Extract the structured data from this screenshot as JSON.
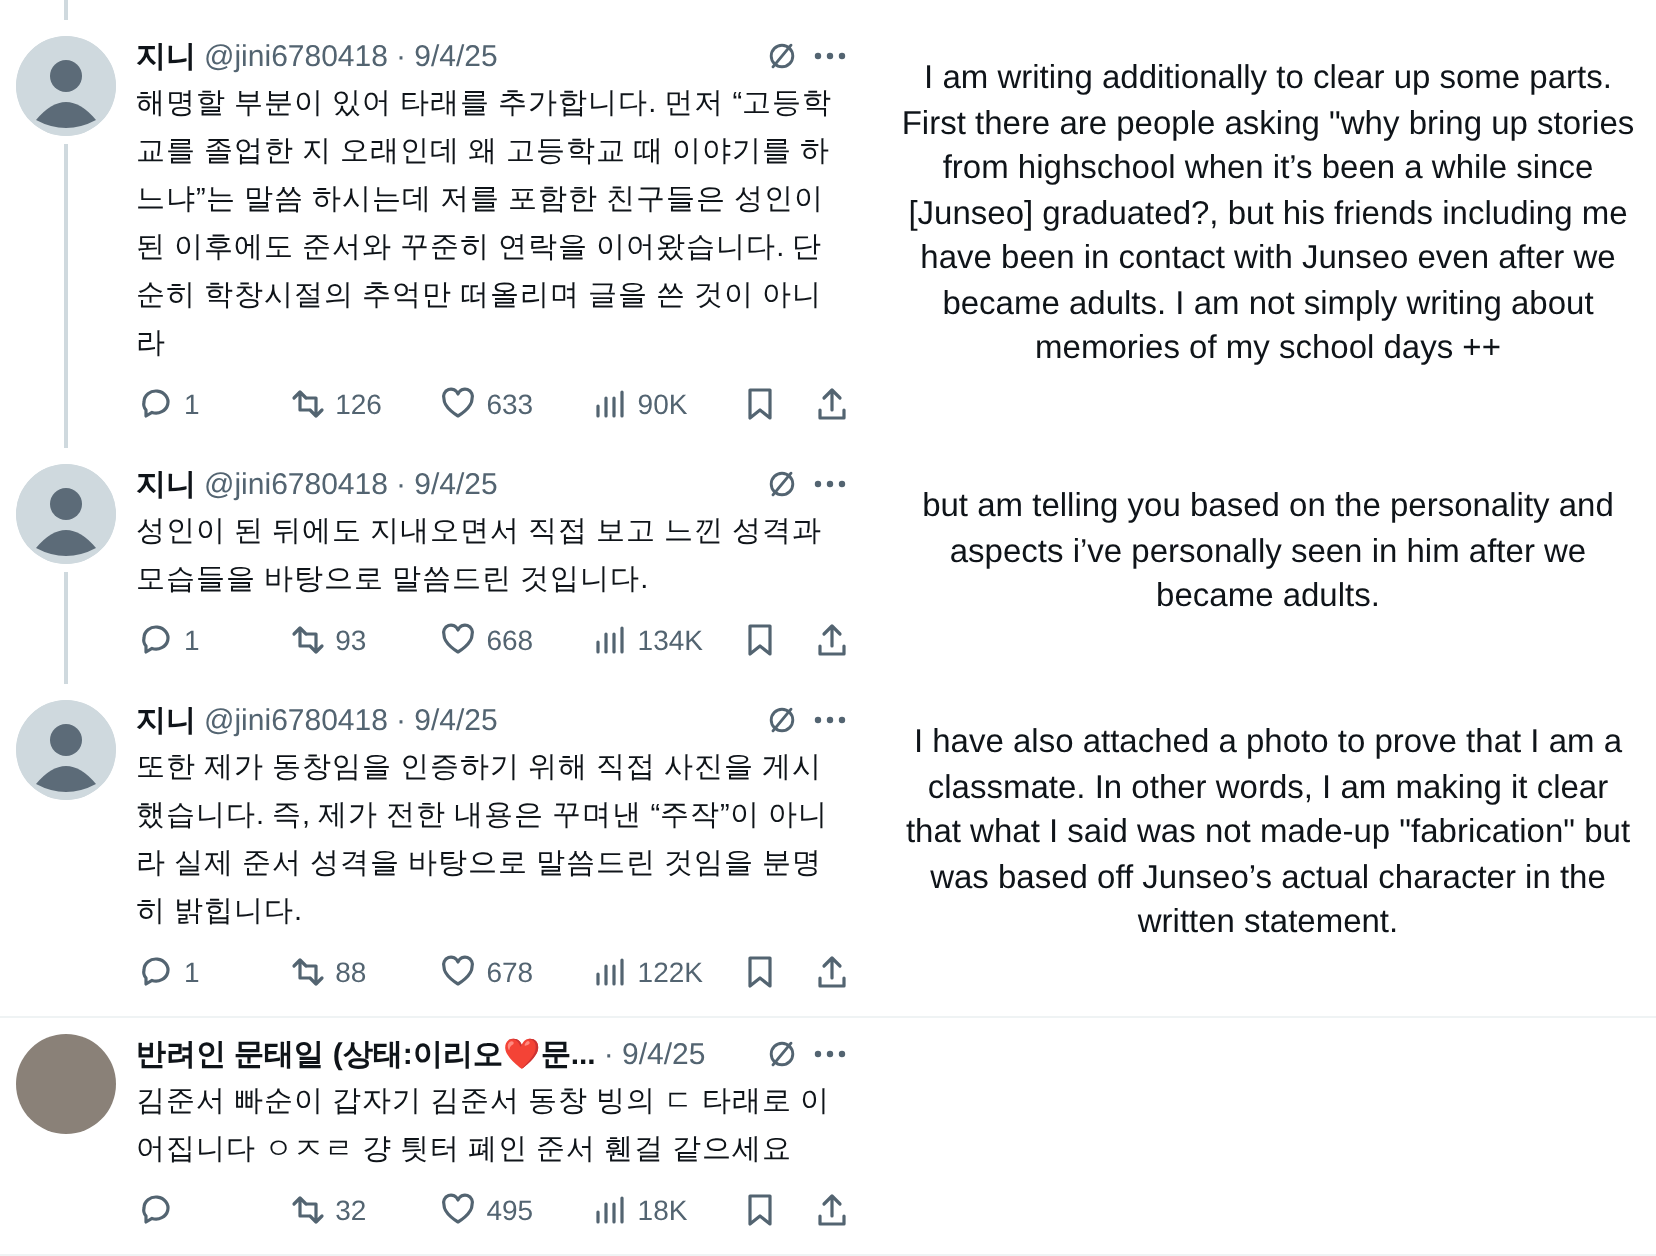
{
  "tweets": [
    {
      "kind": "plain",
      "name": "지니",
      "handle": "@jini6780418",
      "date": "· 9/4/25",
      "thread_line": true,
      "divider": false,
      "text": "해명할 부분이 있어 타래를 추가합니다. 먼저 “고등학교를 졸업한 지 오래인데 왜 고등학교 때 이야기를 하느냐”는 말씀 하시는데 저를 포함한 친구들은 성인이 된 이후에도  준서와 꾸준히 연락을 이어왔습니다. 단순히 학창시절의 추억만 떠올리며 글을 쓴 것이 아니라",
      "replies": "1",
      "reposts": "126",
      "likes": "633",
      "views": "90K",
      "translation": "I am writing additionally to clear up some parts. First there are people asking \"why bring up stories from highschool when it’s been a while since [Junseo] graduated?, but his friends including me have been in contact with Junseo even after we became adults. I am not simply writing about memories of my school days ++"
    },
    {
      "kind": "plain",
      "name": "지니",
      "handle": "@jini6780418",
      "date": "· 9/4/25",
      "thread_line": true,
      "divider": false,
      "text": "성인이 된 뒤에도 지내오면서 직접 보고 느낀 성격과 모습들을 바탕으로 말씀드린 것입니다.",
      "replies": "1",
      "reposts": "93",
      "likes": "668",
      "views": "134K",
      "translation": "but am telling you based on the personality and aspects i’ve personally seen in him after we became adults."
    },
    {
      "kind": "plain",
      "name": "지니",
      "handle": "@jini6780418",
      "date": "· 9/4/25",
      "thread_line": false,
      "divider": true,
      "text": "또한 제가 동창임을 인증하기 위해 직접 사진을 게시했습니다. 즉, 제가 전한 내용은 꾸며낸 “주작”이 아니라 실제 준서 성격을 바탕으로 말씀드린 것임을 분명히 밝힙니다.",
      "replies": "1",
      "reposts": "88",
      "likes": "678",
      "views": "122K",
      "translation": "I have also attached a photo to prove that I am a classmate. In other words, I am making it clear that what I said was not made-up \"fabrication\" but was based off Junseo’s actual character in the written statement."
    },
    {
      "kind": "photo",
      "name": "반려인 문태일 (상태:이리오❤️문...",
      "date": "· 9/4/25",
      "thread_line": false,
      "divider": true,
      "text": "김준서 빠순이 갑자기 김준서 동창 빙의 ㄷ 타래로 이어집니다 ㅇㅈㄹ 걍 틧터 폐인 준서 휀걸 같으세요",
      "reposts": "32",
      "likes": "495",
      "views": "18K"
    }
  ]
}
